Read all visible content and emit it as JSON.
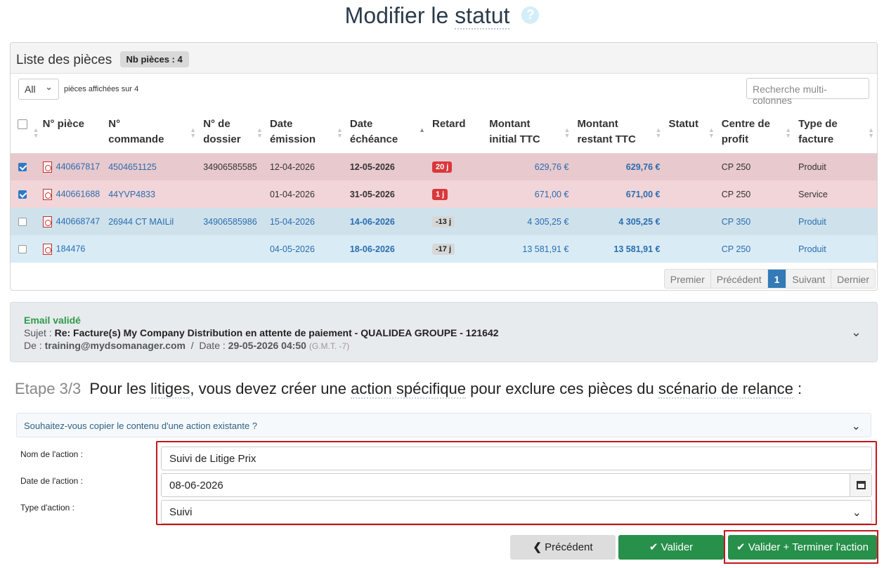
{
  "page": {
    "title_part1": "Modifier le ",
    "title_part2": "statut",
    "help_glyph": "?"
  },
  "pieces": {
    "heading": "Liste des pièces",
    "badge": "Nb pièces : 4",
    "length_value": "All",
    "length_info": "pièces affichées sur 4",
    "search_placeholder": "Recherche multi-colonnes",
    "columns": [
      "N° pièce",
      "N° commande",
      "N° de dossier",
      "Date émission",
      "Date échéance",
      "Retard",
      "Montant initial TTC",
      "Montant restant TTC",
      "Statut",
      "Centre de profit",
      "Type de facture"
    ],
    "rows": [
      {
        "checked": true,
        "piece": "440667817",
        "commande": "4504651125",
        "dossier": "34906585585",
        "emission": "12-04-2026",
        "echeance": "12-05-2026",
        "retard": "20 j",
        "initial": "629,76 €",
        "restant": "629,76 €",
        "statut": "",
        "centre": "CP 250",
        "type": "Produit"
      },
      {
        "checked": true,
        "piece": "440661688",
        "commande": "44YVP4833",
        "dossier": "",
        "emission": "01-04-2026",
        "echeance": "31-05-2026",
        "retard": "1 j",
        "initial": "671,00 €",
        "restant": "671,00 €",
        "statut": "",
        "centre": "CP 250",
        "type": "Service"
      },
      {
        "checked": false,
        "piece": "440668747",
        "commande": "26944 CT MAILil",
        "dossier": "34906585986",
        "emission": "15-04-2026",
        "echeance": "14-06-2026",
        "retard": "-13 j",
        "initial": "4 305,25 €",
        "restant": "4 305,25 €",
        "statut": "",
        "centre": "CP 350",
        "type": "Produit"
      },
      {
        "checked": false,
        "piece": "184476",
        "commande": "",
        "dossier": "",
        "emission": "04-05-2026",
        "echeance": "18-06-2026",
        "retard": "-17 j",
        "initial": "13 581,91 €",
        "restant": "13 581,91 €",
        "statut": "",
        "centre": "CP 250",
        "type": "Produit"
      }
    ],
    "pager": {
      "first": "Premier",
      "prev": "Précédent",
      "current": "1",
      "next": "Suivant",
      "last": "Dernier"
    }
  },
  "email": {
    "status": "Email validé",
    "subject_label": "Sujet :",
    "subject": "Re: Facture(s) My Company Distribution en attente de paiement - QUALIDEA GROUPE - 121642",
    "from_label": "De :",
    "from": "training@mydsomanager.com",
    "sep": "/",
    "date_label": "Date :",
    "date": "29-05-2026 04:50",
    "tz": "(G.M.T. -7)"
  },
  "step": {
    "counter": "Etape 3/3",
    "text_a": "Pour les ",
    "text_b": "litiges",
    "text_c": ", vous devez créer une ",
    "text_d": "action spécifique",
    "text_e": " pour exclure ces pièces du ",
    "text_f": "scénario de relance",
    "text_g": " :"
  },
  "copy_question": "Souhaitez-vous copier le contenu d'une action existante ?",
  "form": {
    "name_label": "Nom de l'action :",
    "name_value": "Suivi de Litige Prix",
    "date_label": "Date de l'action :",
    "date_value": "08-06-2026",
    "type_label": "Type d'action :",
    "type_value": "Suivi"
  },
  "buttons": {
    "prev": "Précédent",
    "validate": "Valider",
    "validate_end": "Valider + Terminer l'action"
  },
  "colors": {
    "accent_green": "#27904b",
    "highlight_red": "#c4161c",
    "link_blue": "#2a6cb0"
  }
}
